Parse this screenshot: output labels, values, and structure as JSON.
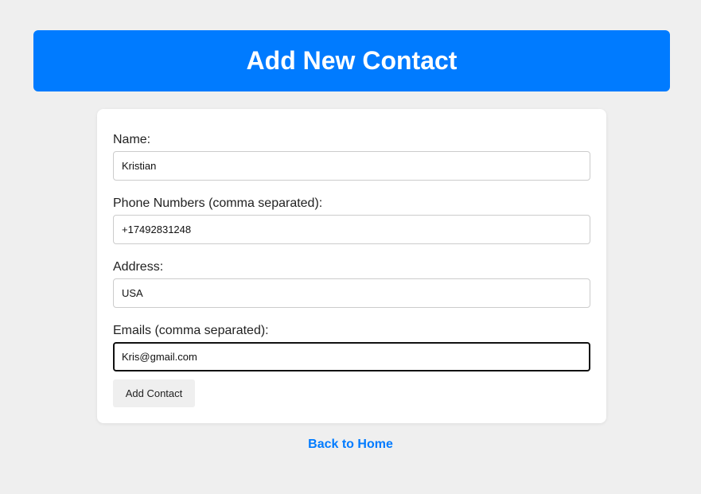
{
  "header": {
    "title": "Add New Contact"
  },
  "form": {
    "name": {
      "label": "Name:",
      "value": "Kristian"
    },
    "phones": {
      "label": "Phone Numbers (comma separated):",
      "value": "+17492831248"
    },
    "address": {
      "label": "Address:",
      "value": "USA"
    },
    "emails": {
      "label": "Emails (comma separated):",
      "value": "Kris@gmail.com"
    },
    "submit_label": "Add Contact"
  },
  "footer": {
    "home_link": "Back to Home"
  },
  "colors": {
    "accent": "#007bff",
    "background": "#efefef",
    "card": "#ffffff"
  }
}
